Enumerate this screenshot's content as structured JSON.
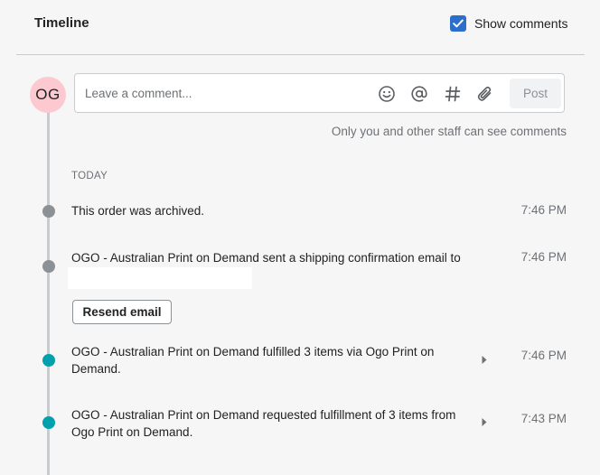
{
  "header": {
    "title": "Timeline",
    "show_comments_label": "Show comments",
    "show_comments_checked": true,
    "checkbox_color": "#2c6ecb"
  },
  "composer": {
    "avatar_initials": "OG",
    "avatar_color": "#fdc9d0",
    "placeholder": "Leave a comment...",
    "tools": [
      "emoji-icon",
      "mention-icon",
      "hashtag-icon",
      "attachment-icon"
    ],
    "post_label": "Post",
    "staff_note": "Only you and other staff can see comments"
  },
  "timeline": {
    "section_label": "TODAY",
    "events": [
      {
        "text": "This order was archived.",
        "time": "7:46 PM",
        "dot_color": "#8c9196"
      },
      {
        "text": "OGO - Australian Print on Demand sent a shipping confirmation email to",
        "time": "7:46 PM",
        "dot_color": "#8c9196",
        "action_label": "Resend email"
      },
      {
        "text_line1": "OGO - Australian Print on Demand fulfilled 3 items via Ogo Print on",
        "text_line2": "Demand.",
        "time": "7:46 PM",
        "dot_color": "#00a0ac"
      },
      {
        "text_line1": "OGO - Australian Print on Demand requested fulfillment of 3 items from",
        "text_line2": "Ogo Print on Demand.",
        "time": "7:43 PM",
        "dot_color": "#00a0ac"
      }
    ]
  }
}
